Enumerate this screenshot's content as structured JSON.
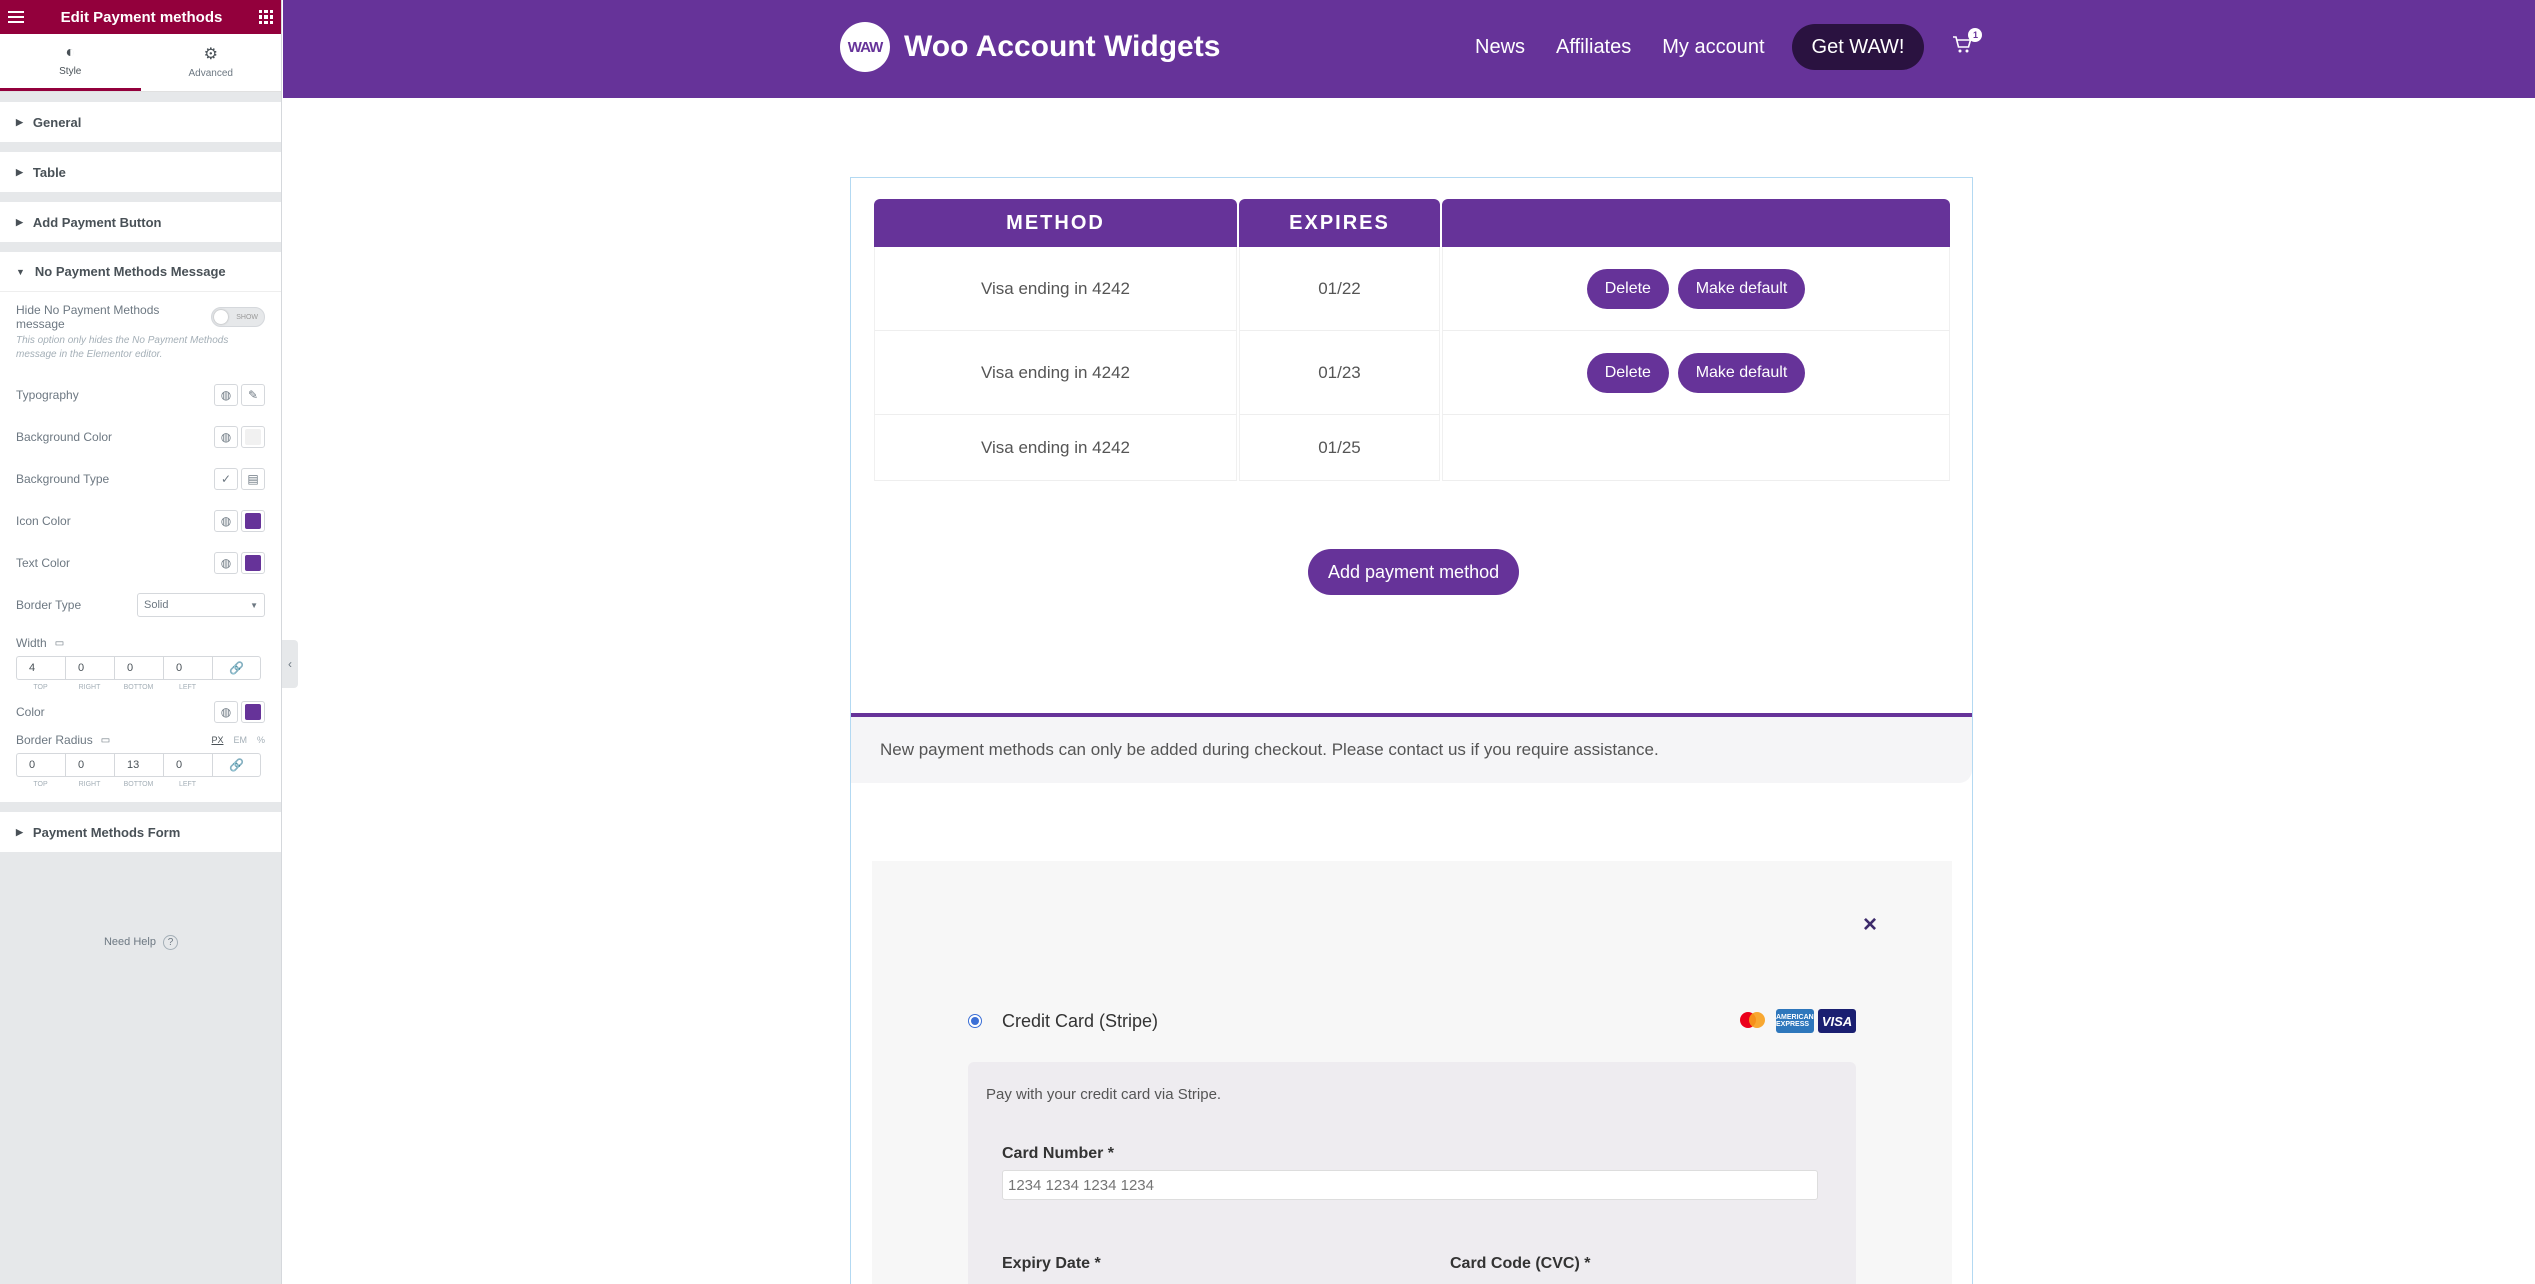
{
  "panel": {
    "title": "Edit Payment methods",
    "tabs": [
      {
        "label": "Style",
        "icon": "half-circle-icon"
      },
      {
        "label": "Advanced",
        "icon": "gear-icon"
      }
    ],
    "sections": {
      "general": "General",
      "table": "Table",
      "add_payment_button": "Add Payment Button",
      "no_payment_message": "No Payment Methods Message",
      "payment_methods_form": "Payment Methods Form"
    },
    "controls": {
      "hide_label": "Hide No Payment Methods message",
      "hide_toggle": "SHOW",
      "hide_note": "This option only hides the No Payment Methods message in the Elementor editor.",
      "typography": "Typography",
      "background_color": "Background Color",
      "background_type": "Background Type",
      "icon_color": "Icon Color",
      "icon_color_value": "#663399",
      "text_color": "Text Color",
      "text_color_value": "#663399",
      "border_type": "Border Type",
      "border_type_value": "Solid",
      "width": "Width",
      "width_values": [
        "4",
        "0",
        "0",
        "0"
      ],
      "dim_labels": [
        "TOP",
        "RIGHT",
        "BOTTOM",
        "LEFT"
      ],
      "color": "Color",
      "color_value": "#663399",
      "border_radius": "Border Radius",
      "units": [
        "PX",
        "EM",
        "%"
      ],
      "radius_values": [
        "0",
        "0",
        "13",
        "0"
      ]
    },
    "need_help": "Need Help"
  },
  "header": {
    "logo_badge": "WAW",
    "site_name": "Woo Account Widgets",
    "nav": [
      "News",
      "Affiliates",
      "My account"
    ],
    "cta": "Get WAW!",
    "cart_count": "1"
  },
  "table": {
    "headers": [
      "METHOD",
      "EXPIRES",
      ""
    ],
    "rows": [
      {
        "method": "Visa ending in 4242",
        "expires": "01/22",
        "actions": [
          "Delete",
          "Make default"
        ]
      },
      {
        "method": "Visa ending in 4242",
        "expires": "01/23",
        "actions": [
          "Delete",
          "Make default"
        ]
      },
      {
        "method": "Visa ending in 4242",
        "expires": "01/25",
        "actions": []
      }
    ]
  },
  "add_payment_label": "Add payment method",
  "notice": "New payment methods can only be added during checkout. Please contact us if you require assistance.",
  "form": {
    "close": "×",
    "gateway_label": "Credit Card (Stripe)",
    "card_brands": [
      "mastercard",
      "amex",
      "visa"
    ],
    "amex_text": "AMERICAN EXPRESS",
    "visa_text": "VISA",
    "description": "Pay with your credit card via Stripe.",
    "card_number_label": "Card Number *",
    "card_number_placeholder": "1234 1234 1234 1234",
    "expiry_label": "Expiry Date *",
    "cvc_label": "Card Code (CVC) *"
  },
  "colors": {
    "brand": "#663399",
    "editor": "#93003c"
  }
}
